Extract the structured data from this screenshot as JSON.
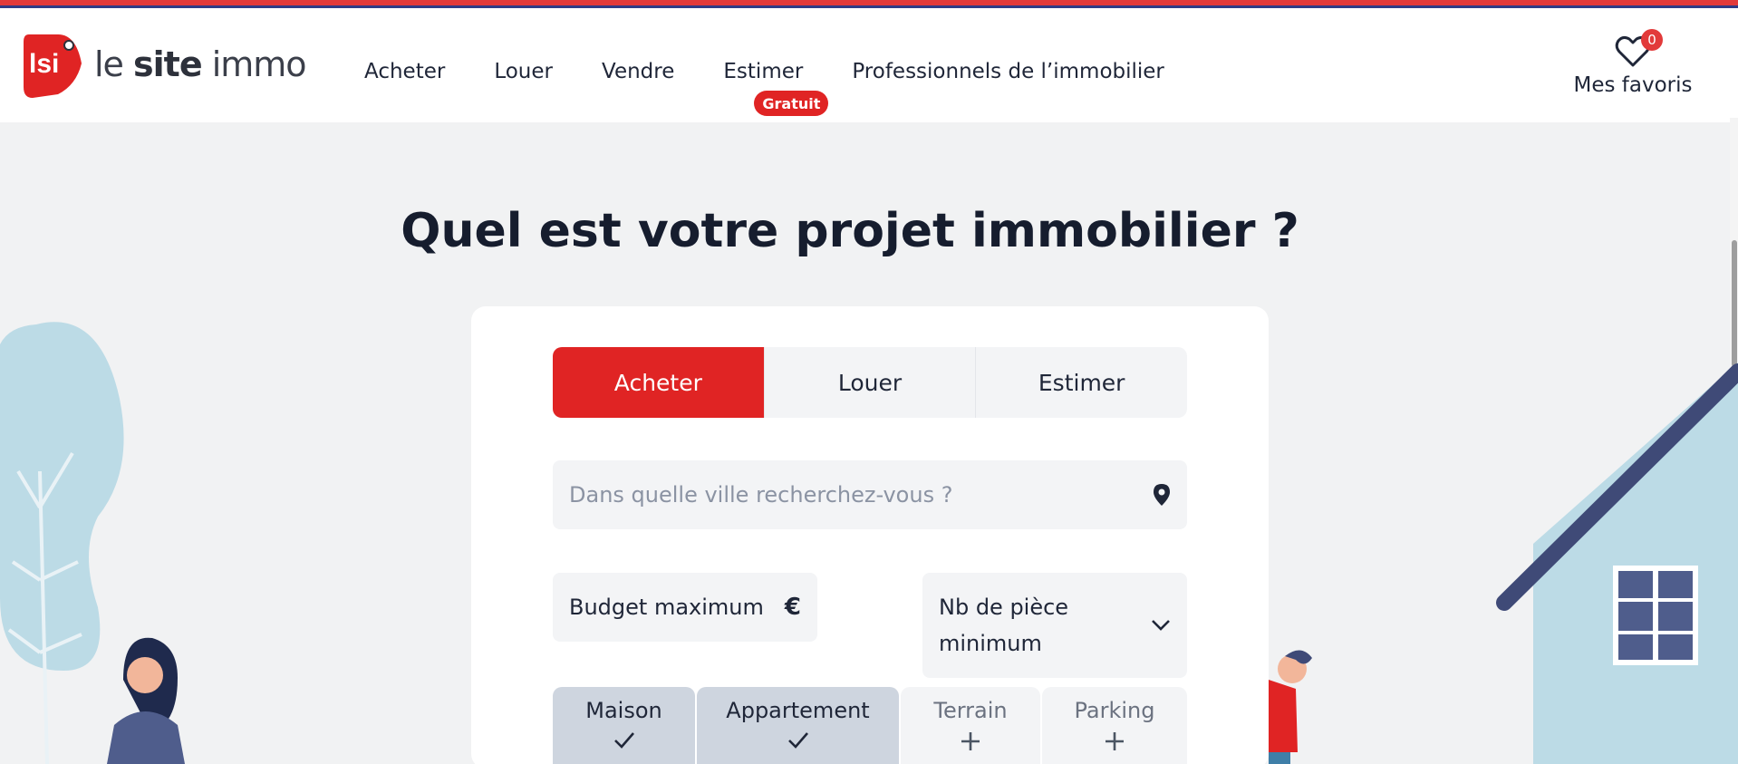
{
  "brand": {
    "logo_badge": "lsi",
    "name_part1": "le",
    "name_part2": "site",
    "name_part3": "immo"
  },
  "nav": {
    "items": [
      "Acheter",
      "Louer",
      "Vendre",
      "Estimer",
      "Professionnels de l’immobilier"
    ],
    "estimer_badge": "Gratuit"
  },
  "favorites": {
    "count": "0",
    "label": "Mes favoris",
    "icon": "heart-icon"
  },
  "hero": {
    "title": "Quel est votre projet immobilier ?"
  },
  "search": {
    "tabs": [
      {
        "label": "Acheter",
        "active": true
      },
      {
        "label": "Louer",
        "active": false
      },
      {
        "label": "Estimer",
        "active": false
      }
    ],
    "city_placeholder": "Dans quelle ville recherchez-vous ?",
    "city_icon": "location-pin-icon",
    "budget_label": "Budget maximum",
    "budget_icon": "€",
    "pieces_label": "Nb de pièce minimum",
    "pieces_icon": "chevron-down-icon",
    "types": [
      {
        "label": "Maison",
        "selected": true
      },
      {
        "label": "Appartement",
        "selected": true
      },
      {
        "label": "Terrain",
        "selected": false
      },
      {
        "label": "Parking",
        "selected": false
      }
    ]
  },
  "colors": {
    "accent": "#e02424",
    "nav_blue": "#2f3b86",
    "background": "#f1f2f3",
    "selected_type": "#ced5df",
    "house": "#bcdbe6",
    "roof": "#3f4a77"
  }
}
